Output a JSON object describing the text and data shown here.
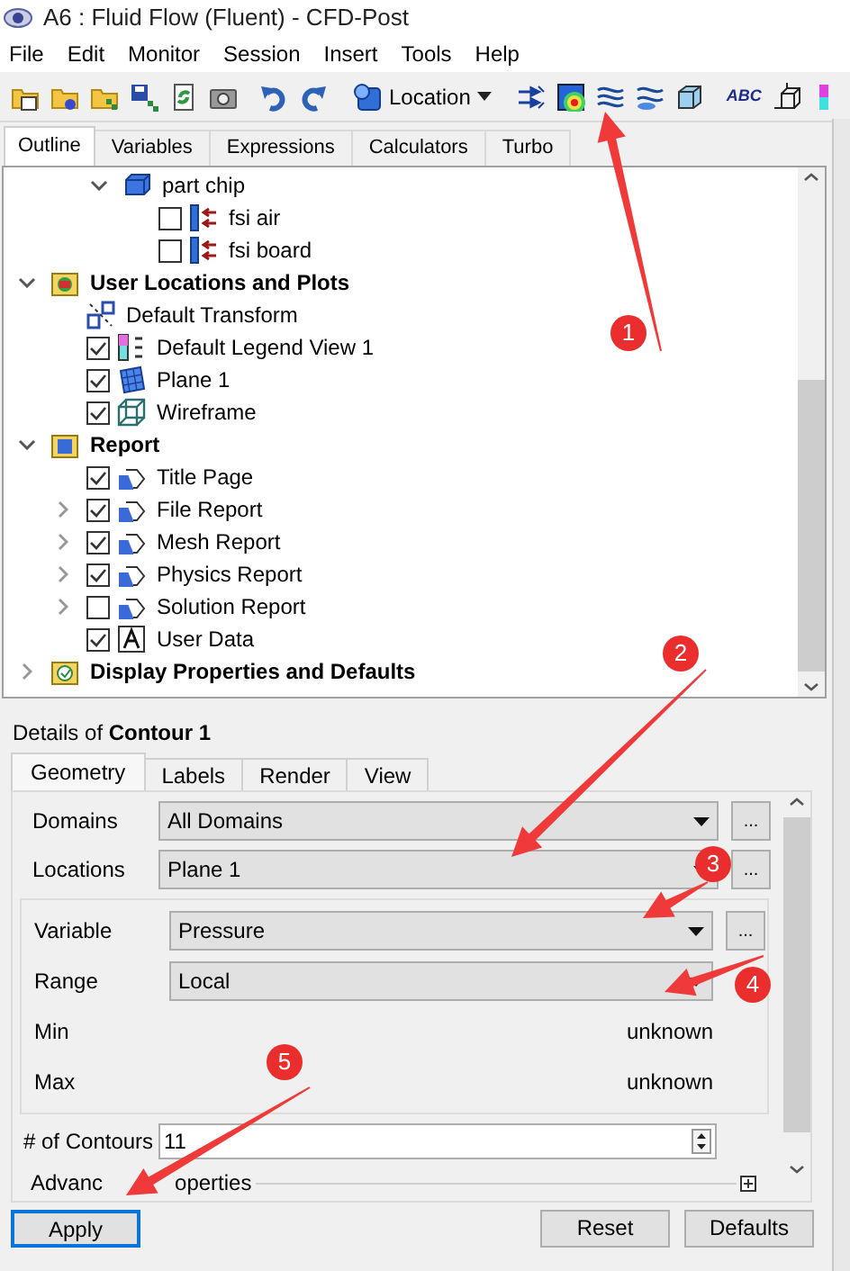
{
  "window": {
    "title": "A6 : Fluid Flow (Fluent) - CFD-Post"
  },
  "menu": [
    "File",
    "Edit",
    "Monitor",
    "Session",
    "Insert",
    "Tools",
    "Help"
  ],
  "toolbar": {
    "location_button": "Location",
    "text_tool": "ABC"
  },
  "tabs": [
    {
      "label": "Outline",
      "selected": true
    },
    {
      "label": "Variables",
      "selected": false
    },
    {
      "label": "Expressions",
      "selected": false
    },
    {
      "label": "Calculators",
      "selected": false
    },
    {
      "label": "Turbo",
      "selected": false
    }
  ],
  "tree": {
    "continued_items": [
      {
        "label": "part chip",
        "kind": "part",
        "expanded": true,
        "children": [
          {
            "label": "fsi air",
            "kind": "boundary",
            "checked": false
          },
          {
            "label": "fsi board",
            "kind": "boundary",
            "checked": false
          }
        ]
      }
    ],
    "items": [
      {
        "label": "User Locations and Plots",
        "kind": "folder-locations",
        "expanded": true,
        "children": [
          {
            "label": "Default Transform",
            "kind": "transform"
          },
          {
            "label": "Default Legend View 1",
            "kind": "legend",
            "checked": true
          },
          {
            "label": "Plane 1",
            "kind": "plane",
            "checked": true
          },
          {
            "label": "Wireframe",
            "kind": "wireframe",
            "checked": true
          }
        ]
      },
      {
        "label": "Report",
        "kind": "folder-report",
        "expanded": true,
        "children": [
          {
            "label": "Title Page",
            "kind": "report-page",
            "checked": true
          },
          {
            "label": "File Report",
            "kind": "report-page",
            "checked": true,
            "expanded": false
          },
          {
            "label": "Mesh Report",
            "kind": "report-page",
            "checked": true,
            "expanded": false
          },
          {
            "label": "Physics Report",
            "kind": "report-page",
            "checked": true,
            "expanded": false
          },
          {
            "label": "Solution Report",
            "kind": "report-page",
            "checked": false,
            "expanded": false
          },
          {
            "label": "User Data",
            "kind": "user-data",
            "checked": true
          }
        ]
      },
      {
        "label": "Display Properties and Defaults",
        "kind": "folder-display",
        "expanded": false
      }
    ]
  },
  "details": {
    "title": "Details of **Contour 1**",
    "tabs": [
      {
        "label": "Geometry",
        "selected": true
      },
      {
        "label": "Labels",
        "selected": false
      },
      {
        "label": "Render",
        "selected": false
      },
      {
        "label": "View",
        "selected": false
      }
    ],
    "rows": [
      {
        "label": "Domains",
        "kind": "dropdown",
        "value": "All Domains",
        "more": "..."
      },
      {
        "label": "Locations",
        "kind": "dropdown",
        "value": "Plane 1",
        "more": "..."
      }
    ],
    "group": [
      {
        "label": "Variable",
        "kind": "dropdown",
        "value": "Pressure",
        "more": "..."
      },
      {
        "label": "Range",
        "kind": "dropdown",
        "value": "Local"
      },
      {
        "label": "Min",
        "kind": "readout",
        "value": "unknown"
      },
      {
        "label": "Max",
        "kind": "readout",
        "value": "unknown"
      }
    ],
    "contours": {
      "label": "# of Contours",
      "value": "11"
    },
    "advanced": [
      "Advanc",
      "operties"
    ]
  },
  "buttons": [
    {
      "label": "Apply",
      "default": true
    },
    {
      "label": "Reset",
      "default": false
    },
    {
      "label": "Defaults",
      "default": false
    }
  ],
  "annotations": [
    {
      "label": "1"
    },
    {
      "label": "2"
    },
    {
      "label": "3"
    },
    {
      "label": "4"
    },
    {
      "label": "5"
    }
  ]
}
